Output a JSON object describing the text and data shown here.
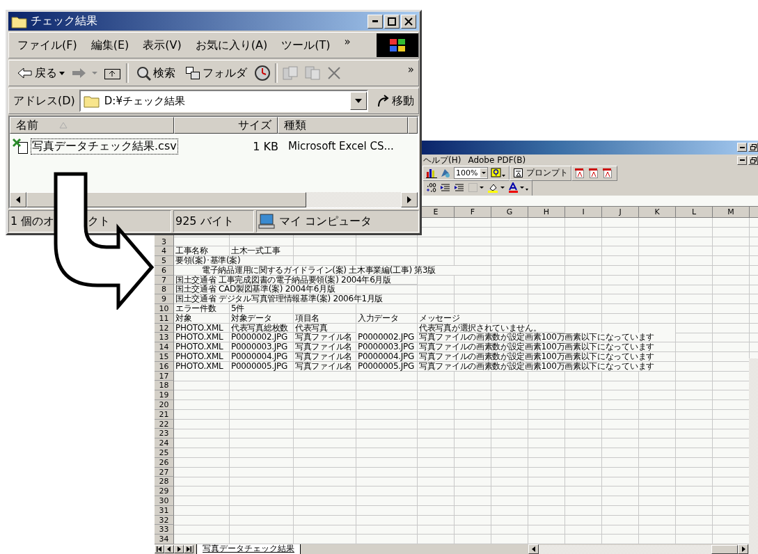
{
  "explorer": {
    "title": "チェック結果",
    "menu": [
      "ファイル(F)",
      "編集(E)",
      "表示(V)",
      "お気に入り(A)",
      "ツール(T)"
    ],
    "menu_more": "»",
    "toolbar": {
      "back": "戻る",
      "search": "検索",
      "folders": "フォルダ",
      "more": "»"
    },
    "address": {
      "label": "アドレス(D)",
      "value": "D:¥チェック結果",
      "go": "移動"
    },
    "columns": [
      "名前",
      "サイズ",
      "種類"
    ],
    "files": [
      {
        "name": "写真データチェック結果.csv",
        "size": "1 KB",
        "type": "Microsoft Excel CS..."
      }
    ],
    "status": {
      "objects_start": "1 個のオ",
      "objects_end": "クト",
      "size": "925 バイト",
      "zone": "マイ コンピュータ"
    }
  },
  "excel": {
    "menu": [
      "ヘルプ(H)",
      "Adobe PDF(B)"
    ],
    "zoom": "100%",
    "prompt": "プロンプト",
    "column_headers": [
      "E",
      "F",
      "G",
      "H",
      "I",
      "J",
      "K",
      "L",
      "M"
    ],
    "rows": [
      {
        "number": "3",
        "kind": "plain",
        "cells": []
      },
      {
        "number": "4",
        "kind": "plain",
        "cells": [
          "工事名称",
          "土木一式工事"
        ]
      },
      {
        "number": "5",
        "kind": "plain",
        "cells": [
          "要領(案)･基準(案)"
        ]
      },
      {
        "number": "6",
        "kind": "indented",
        "cells": [
          "電子納品運用に関するガイドライン(案) 土木事業編(工事) 第3版"
        ]
      },
      {
        "number": "7",
        "kind": "plain",
        "cells": [
          "国土交通省 工事完成図書の電子納品要領(案) 2004年6月版"
        ]
      },
      {
        "number": "8",
        "kind": "plain",
        "cells": [
          "国土交通省 CAD製図基準(案) 2004年6月版"
        ]
      },
      {
        "number": "9",
        "kind": "plain",
        "cells": [
          "国土交通省 デジタル写真管理情報基準(案) 2006年1月版"
        ]
      },
      {
        "number": "10",
        "kind": "plain",
        "cells": [
          "エラー件数",
          "5件"
        ]
      },
      {
        "number": "11",
        "kind": "plain",
        "cells": [
          "対象",
          "対象データ",
          "項目名",
          "入力データ",
          "メッセージ"
        ]
      },
      {
        "number": "12",
        "kind": "plain",
        "cells": [
          "PHOTO.XML",
          "代表写真総枚数",
          "代表写真",
          null,
          "代表写真が選択されていません。"
        ]
      },
      {
        "number": "13",
        "kind": "plain",
        "cells": [
          "PHOTO.XML",
          "P0000002.JPG",
          "写真ファイル名",
          "P0000002.JPG",
          "写真ファイルの画素数が設定画素100万画素以下になっています"
        ]
      },
      {
        "number": "14",
        "kind": "plain",
        "cells": [
          "PHOTO.XML",
          "P0000003.JPG",
          "写真ファイル名",
          "P0000003.JPG",
          "写真ファイルの画素数が設定画素100万画素以下になっています"
        ]
      },
      {
        "number": "15",
        "kind": "plain",
        "cells": [
          "PHOTO.XML",
          "P0000004.JPG",
          "写真ファイル名",
          "P0000004.JPG",
          "写真ファイルの画素数が設定画素100万画素以下になっています"
        ]
      },
      {
        "number": "16",
        "kind": "plain",
        "cells": [
          "PHOTO.XML",
          "P0000005.JPG",
          "写真ファイル名",
          "P0000005.JPG",
          "写真ファイルの画素数が設定画素100万画素以下になっています"
        ]
      },
      {
        "number": "17",
        "kind": "plain",
        "cells": []
      },
      {
        "number": "18",
        "kind": "plain",
        "cells": []
      },
      {
        "number": "19",
        "kind": "plain",
        "cells": []
      },
      {
        "number": "20",
        "kind": "plain",
        "cells": []
      },
      {
        "number": "21",
        "kind": "plain",
        "cells": []
      },
      {
        "number": "22",
        "kind": "plain",
        "cells": []
      },
      {
        "number": "23",
        "kind": "plain",
        "cells": []
      },
      {
        "number": "24",
        "kind": "plain",
        "cells": []
      },
      {
        "number": "25",
        "kind": "plain",
        "cells": []
      },
      {
        "number": "26",
        "kind": "plain",
        "cells": []
      },
      {
        "number": "27",
        "kind": "plain",
        "cells": []
      },
      {
        "number": "28",
        "kind": "plain",
        "cells": []
      },
      {
        "number": "29",
        "kind": "plain",
        "cells": []
      },
      {
        "number": "30",
        "kind": "plain",
        "cells": []
      },
      {
        "number": "31",
        "kind": "plain",
        "cells": []
      },
      {
        "number": "32",
        "kind": "plain",
        "cells": []
      },
      {
        "number": "33",
        "kind": "plain",
        "cells": []
      },
      {
        "number": "34",
        "kind": "plain",
        "cells": []
      }
    ],
    "sheet_tabs": [
      {
        "label": "写真データチェック結果",
        "selected": true
      }
    ]
  }
}
